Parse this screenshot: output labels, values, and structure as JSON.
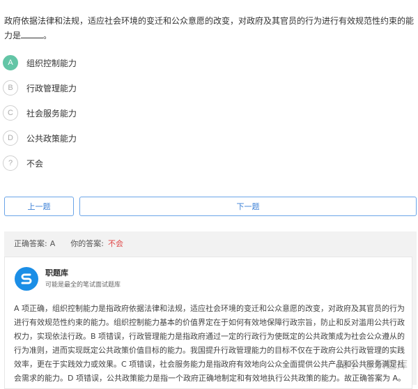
{
  "question": {
    "text": "政府依据法律和法规，适应社会环境的变迁和公众意愿的改变，对政府及其官员的行为进行有效规范性约束的能力是",
    "suffix": "。"
  },
  "options": [
    {
      "letter": "A",
      "label": "组织控制能力",
      "selected": true
    },
    {
      "letter": "B",
      "label": "行政管理能力",
      "selected": false
    },
    {
      "letter": "C",
      "label": "社会服务能力",
      "selected": false
    },
    {
      "letter": "D",
      "label": "公共政策能力",
      "selected": false
    },
    {
      "letter": "?",
      "label": "不会",
      "selected": false
    }
  ],
  "nav": {
    "prev_label": "上一题",
    "next_label": "下一题"
  },
  "answer": {
    "correct_label": "正确答案:",
    "correct_value": "A",
    "yours_label": "你的答案:",
    "yours_value": "不会",
    "yours_color": "#e04545"
  },
  "brand": {
    "name": "职题库",
    "subtitle": "可能是最全的笔试面试题库",
    "logo_icon": "s-logo-icon",
    "color": "#1b8ee6"
  },
  "explanation": "A 项正确，组织控制能力是指政府依据法律和法规，适应社会环境的变迁和公众意愿的改变，对政府及其官员的行为进行有效规范性约束的能力。组织控制能力基本的价值界定在于如何有效地保障行政宗旨，防止和反对滥用公共行政权力，实现依法行政。B 项错误，行政管理能力是指政府通过一定的行政行为使既定的公共政策成为社会公众遵从的行为准则，进而实现既定公共政策价值目标的能力。我国提升行政管理能力的目标不仅在于政府公共行政管理的实践效率，更在于实践效力或效果。C 项错误，社会服务能力是指政府有效地向公众全面提供公共产品和公共服务满足社会需求的能力。D 项错误，公共政策能力是指一个政府正确地制定和有效地执行公共政策的能力。故正确答案为 A。",
  "watermark": "知乎 @职题库",
  "accent_color": "#63c5a6"
}
